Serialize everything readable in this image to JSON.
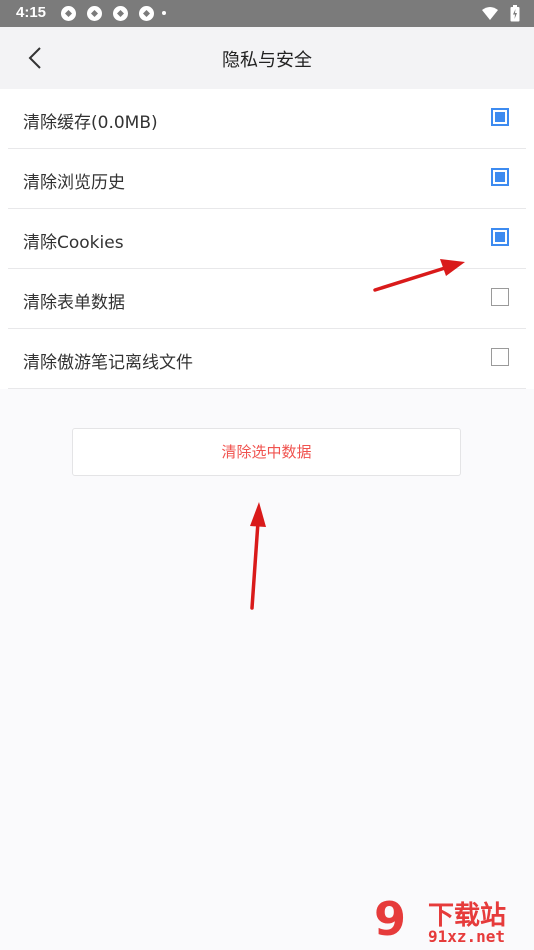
{
  "status_bar": {
    "time": "4:15"
  },
  "header": {
    "title": "隐私与安全"
  },
  "options": [
    {
      "label": "清除缓存(0.0MB)",
      "checked": true
    },
    {
      "label": "清除浏览历史",
      "checked": true
    },
    {
      "label": "清除Cookies",
      "checked": true
    },
    {
      "label": "清除表单数据",
      "checked": false
    },
    {
      "label": "清除傲游笔记离线文件",
      "checked": false
    }
  ],
  "action": {
    "clear_label": "清除选中数据"
  },
  "watermark": {
    "mark": "9",
    "title": "下载站",
    "url": "91xz.net"
  },
  "colors": {
    "accent": "#3d8bf0",
    "danger_text": "#f0534f",
    "arrow": "#d91a1a"
  }
}
